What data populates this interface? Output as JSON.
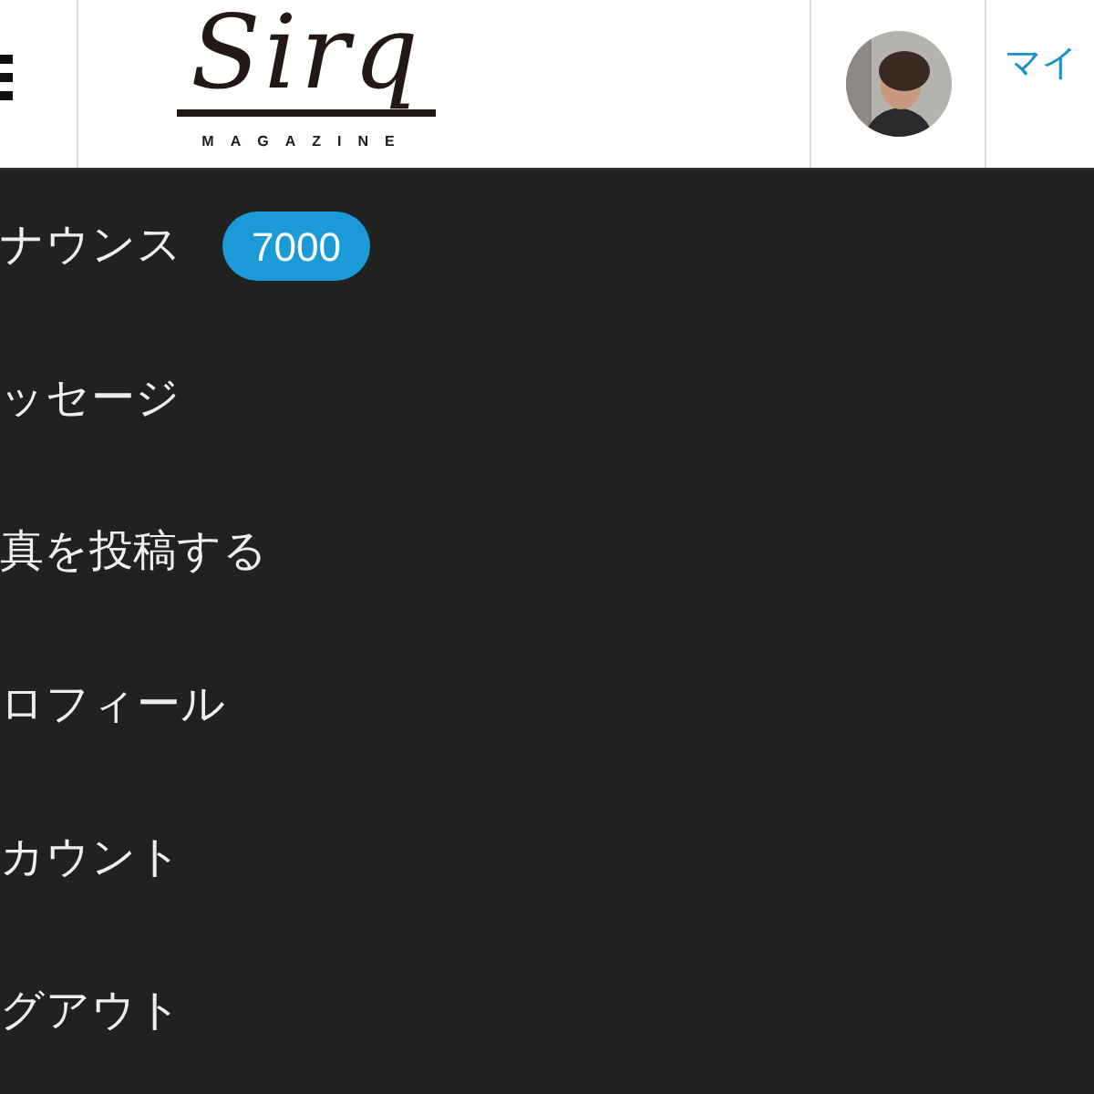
{
  "header": {
    "logo": {
      "wordmark": "Sirq",
      "tagline": "MAGAZINE"
    },
    "mypage_link": "マイ"
  },
  "menu": {
    "items": [
      {
        "label": "ナウンス",
        "badge": "7000"
      },
      {
        "label": "ッセージ"
      },
      {
        "label": "真を投稿する"
      },
      {
        "label": "ロフィール"
      },
      {
        "label": "カウント"
      },
      {
        "label": "グアウト"
      }
    ]
  }
}
